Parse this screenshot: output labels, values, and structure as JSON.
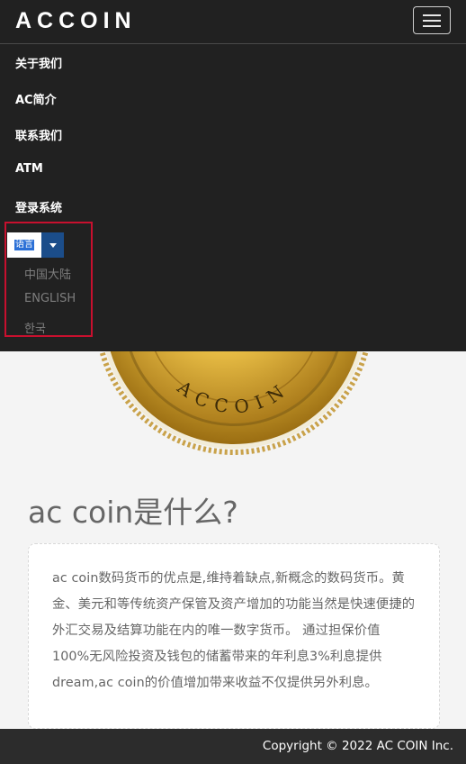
{
  "header": {
    "brand": "ACCOIN",
    "menu_toggle_icon": "hamburger-icon"
  },
  "nav": {
    "items": [
      {
        "label": "关于我们"
      },
      {
        "label": "AC简介"
      },
      {
        "label": "联系我们"
      },
      {
        "label": "ATM"
      },
      {
        "label": "登录系统"
      }
    ],
    "language": {
      "button_label": "语言",
      "caret_icon": "caret-down-icon",
      "options": [
        "中国大陆",
        "ENGLISH",
        "한국"
      ]
    }
  },
  "coin": {
    "text": "ACCOIN"
  },
  "main": {
    "heading": "ac coin是什么?",
    "description": "ac coin数码货币的优点是,维持着缺点,新概念的数码货币。黄金、美元和等传统资产保管及资产增加的功能当然是快速便捷的外汇交易及结算功能在内的唯一数字货币。 通过担保价值100%无风险投资及钱包的储蓄带来的年利息3%利息提供dream,ac coin的价值增加带来收益不仅提供另外利息。"
  },
  "footer": {
    "copyright": "Copyright © 2022 AC COIN Inc."
  },
  "colors": {
    "navbar": "#212121",
    "highlight_border": "#c8102e",
    "caret_button": "#1b4d8a",
    "footer": "#2c2c2c",
    "gold": "#d4a52a"
  }
}
